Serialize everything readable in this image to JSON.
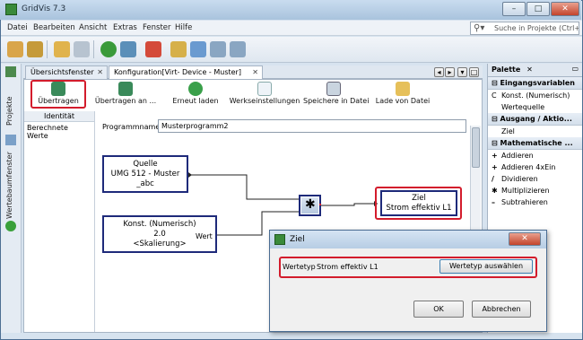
{
  "window": {
    "title": "GridVis 7.3",
    "controls": [
      "–",
      "□",
      "✕"
    ]
  },
  "menu": [
    "Datei",
    "Bearbeiten",
    "Ansicht",
    "Extras",
    "Fenster",
    "Hilfe"
  ],
  "search": {
    "placeholder": "Suche in Projekte (Ctrl+I)"
  },
  "left_strip": {
    "tab1": "Projekte",
    "tab2": "Wertebaumfenster"
  },
  "tabs": [
    {
      "label": "Übersichtsfenster"
    },
    {
      "label": "Konfiguration[Virt- Device - Muster]"
    }
  ],
  "config_toolbar": [
    {
      "label": "Übertragen"
    },
    {
      "label": "Übertragen an ..."
    },
    {
      "label": "Erneut laden"
    },
    {
      "label": "Werkseinstellungen"
    },
    {
      "label": "Speichere in Datei"
    },
    {
      "label": "Lade von Datei"
    }
  ],
  "side_list": {
    "header": "Identität",
    "item": "Berechnete Werte"
  },
  "program": {
    "label": "Programmname",
    "value": "Musterprogramm2"
  },
  "nodes": {
    "quelle": {
      "line1": "Quelle",
      "line2": "UMG 512 - Muster",
      "line3": "_abc"
    },
    "konst": {
      "line1": "Konst. (Numerisch)",
      "line2": "2.0",
      "line3": "<Skalierung>",
      "port": "Wert"
    },
    "ziel": {
      "line1": "Ziel",
      "line2": "Strom effektiv L1"
    },
    "multiply_symbol": "✱"
  },
  "palette": {
    "title": "Palette",
    "sections": [
      {
        "head": "Eingangsvariablen",
        "items": [
          "Konst. (Numerisch)",
          "Wertequelle"
        ]
      },
      {
        "head": "Ausgang / Aktio...",
        "items": [
          "Ziel"
        ]
      },
      {
        "head": "Mathematische ...",
        "items": [
          "Addieren",
          "Addieren 4xEin",
          "Dividieren",
          "Multiplizieren",
          "Subtrahieren"
        ]
      }
    ]
  },
  "dialog": {
    "title": "Ziel",
    "field_label": "Wertetyp",
    "field_value": "Strom effektiv L1",
    "select_button": "Wertetyp auswählen",
    "ok": "OK",
    "cancel": "Abbrechen"
  },
  "colors": {
    "highlight": "#d31c2c",
    "node_border": "#1e2a7a"
  }
}
